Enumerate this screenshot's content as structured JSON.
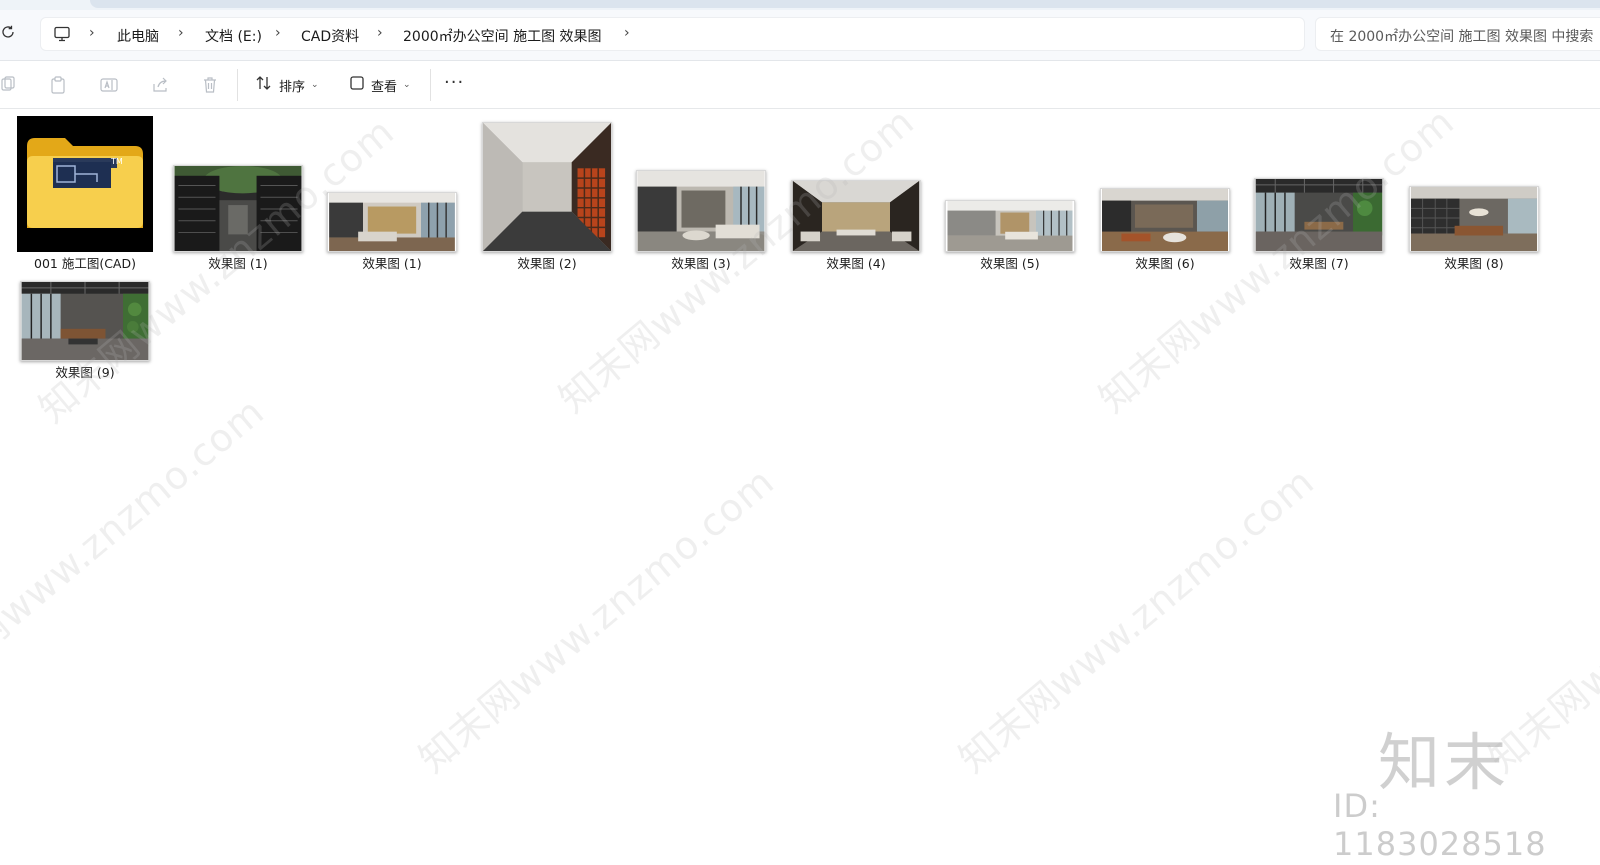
{
  "breadcrumb": {
    "items": [
      "此电脑",
      "文档 (E:)",
      "CAD资料",
      "2000㎡办公空间 施工图 效果图"
    ],
    "separator": "›"
  },
  "search": {
    "placeholder": "在 2000㎡办公空间 施工图 效果图 中搜索"
  },
  "toolbar": {
    "sort_label": "排序",
    "view_label": "查看",
    "more_label": "···",
    "icons": [
      "copy-icon",
      "paste-icon",
      "rename-icon",
      "share-icon",
      "delete-icon",
      "sort-icon",
      "view-icon",
      "more-icon"
    ]
  },
  "files": [
    {
      "name": "001 施工图(CAD)",
      "kind": "folder"
    },
    {
      "name": "效果图 (1)",
      "kind": "image"
    },
    {
      "name": "效果图 (1)",
      "kind": "image"
    },
    {
      "name": "效果图 (2)",
      "kind": "image"
    },
    {
      "name": "效果图 (3)",
      "kind": "image"
    },
    {
      "name": "效果图 (4)",
      "kind": "image"
    },
    {
      "name": "效果图 (5)",
      "kind": "image"
    },
    {
      "name": "效果图 (6)",
      "kind": "image"
    },
    {
      "name": "效果图 (7)",
      "kind": "image"
    },
    {
      "name": "效果图 (8)",
      "kind": "image"
    },
    {
      "name": "效果图 (9)",
      "kind": "image"
    }
  ],
  "watermark": {
    "text": "知末网www.znzmo.com",
    "logo": "知末",
    "id": "ID: 1183028518"
  },
  "colors": {
    "folder_yellow": "#f5c842",
    "background": "#ffffff",
    "toolbar_bg": "#f7f9fc"
  }
}
